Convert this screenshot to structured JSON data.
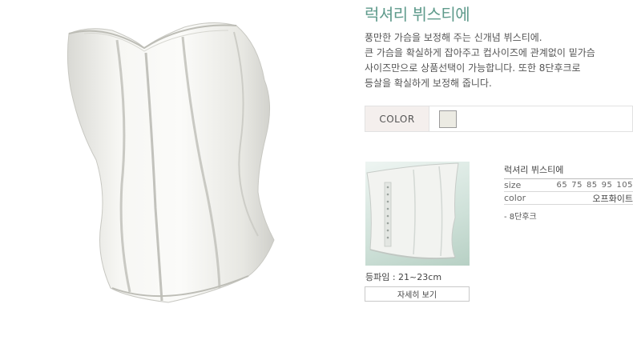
{
  "product": {
    "title": "럭셔리 뷔스티에",
    "description_lines": [
      "풍만한 가슴을 보정해 주는 신개념 뷔스티에.",
      "큰 가슴을 확실하게 잡아주고 컵사이즈에 관계없이 밑가슴",
      "사이즈만으로 상품선택이 가능합니다. 또한 8단후크로",
      "등살을 확실하게 보정해 줍니다."
    ],
    "main_image_icon": "bustier-front-image",
    "thumbnail_icon": "bustier-back-image"
  },
  "color_option": {
    "label": "COLOR",
    "chips": [
      {
        "name": "오프화이트",
        "hex": "#ecebe3"
      }
    ]
  },
  "detail": {
    "pad_label": "등파임 : 21~23cm",
    "button_label": "자세히 보기"
  },
  "spec": {
    "title": "럭셔리 뷔스티에",
    "size_key": "size",
    "sizes": [
      "65",
      "75",
      "85",
      "95",
      "105"
    ],
    "color_key": "color",
    "color_value": "오프화이트",
    "note": "- 8단후크"
  },
  "colors": {
    "title_accent": "#5f9b8c",
    "label_bg": "#f4efed"
  }
}
